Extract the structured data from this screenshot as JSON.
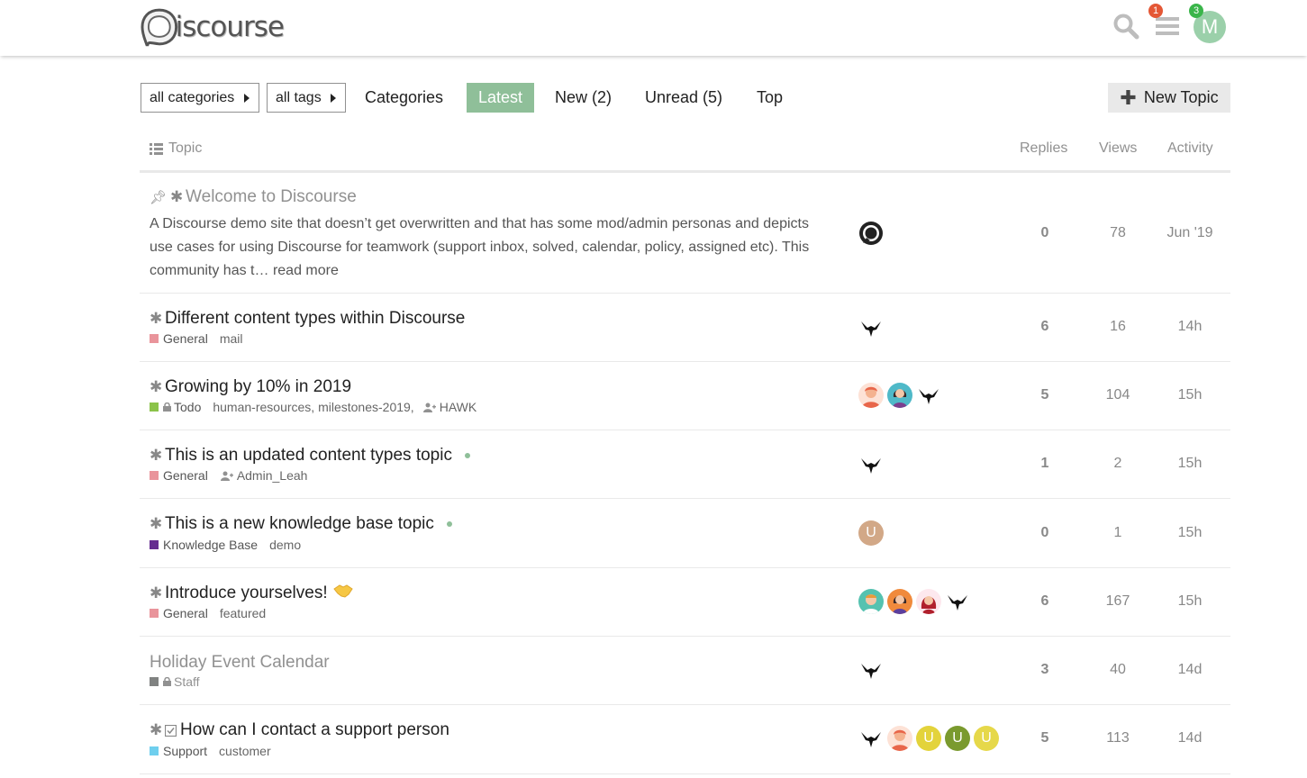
{
  "header": {
    "logo_text": "iscourse",
    "notifications_count": "1",
    "messages_count": "3",
    "user_initial": "M",
    "user_avatar_color": "#9bd0aa"
  },
  "nav": {
    "category_filter": "all categories",
    "tag_filter": "all tags",
    "links": [
      "Categories",
      "Latest",
      "New (2)",
      "Unread (5)",
      "Top"
    ],
    "active": "Latest",
    "new_topic_label": "New Topic"
  },
  "table_header": {
    "topic": "Topic",
    "replies": "Replies",
    "views": "Views",
    "activity": "Activity"
  },
  "topics": [
    {
      "title": "Welcome to Discourse",
      "pinned": true,
      "excerpt": "A Discourse demo site that doesn’t get overwritten and that has some mod/admin personas and depicts use cases for using Discourse for teamwork (support inbox, solved, calendar, policy, assigned etc). This community has t…",
      "read_more": "read more",
      "replies": "0",
      "views": "78",
      "activity": "Jun '19"
    },
    {
      "title": "Different content types within Discourse",
      "category": "General",
      "category_color": "#e9949b",
      "tags": "mail",
      "replies": "6",
      "views": "16",
      "activity": "14h"
    },
    {
      "title": "Growing by 10% in 2019",
      "category": "Todo",
      "category_color": "#8bc34a",
      "tags": "human-resources, milestones-2019,",
      "assigned": "HAWK",
      "replies": "5",
      "views": "104",
      "activity": "15h"
    },
    {
      "title": "This is an updated content types topic",
      "category": "General",
      "category_color": "#e9949b",
      "assigned": "Admin_Leah",
      "replies": "1",
      "views": "2",
      "activity": "15h"
    },
    {
      "title": "This is a new knowledge base topic",
      "category": "Knowledge Base",
      "category_color": "#652d90",
      "tags": "demo",
      "replies": "0",
      "views": "1",
      "activity": "15h"
    },
    {
      "title": "Introduce yourselves!",
      "category": "General",
      "category_color": "#e9949b",
      "tags": "featured",
      "replies": "6",
      "views": "167",
      "activity": "15h"
    },
    {
      "title": "Holiday Event Calendar",
      "category": "Staff",
      "category_color": "#808281",
      "replies": "3",
      "views": "40",
      "activity": "14d"
    },
    {
      "title": "How can I contact a support person",
      "category": "Support",
      "category_color": "#6fcfee",
      "tags": "customer",
      "replies": "5",
      "views": "113",
      "activity": "14d"
    }
  ],
  "avatar_letters": {
    "u": "U"
  }
}
